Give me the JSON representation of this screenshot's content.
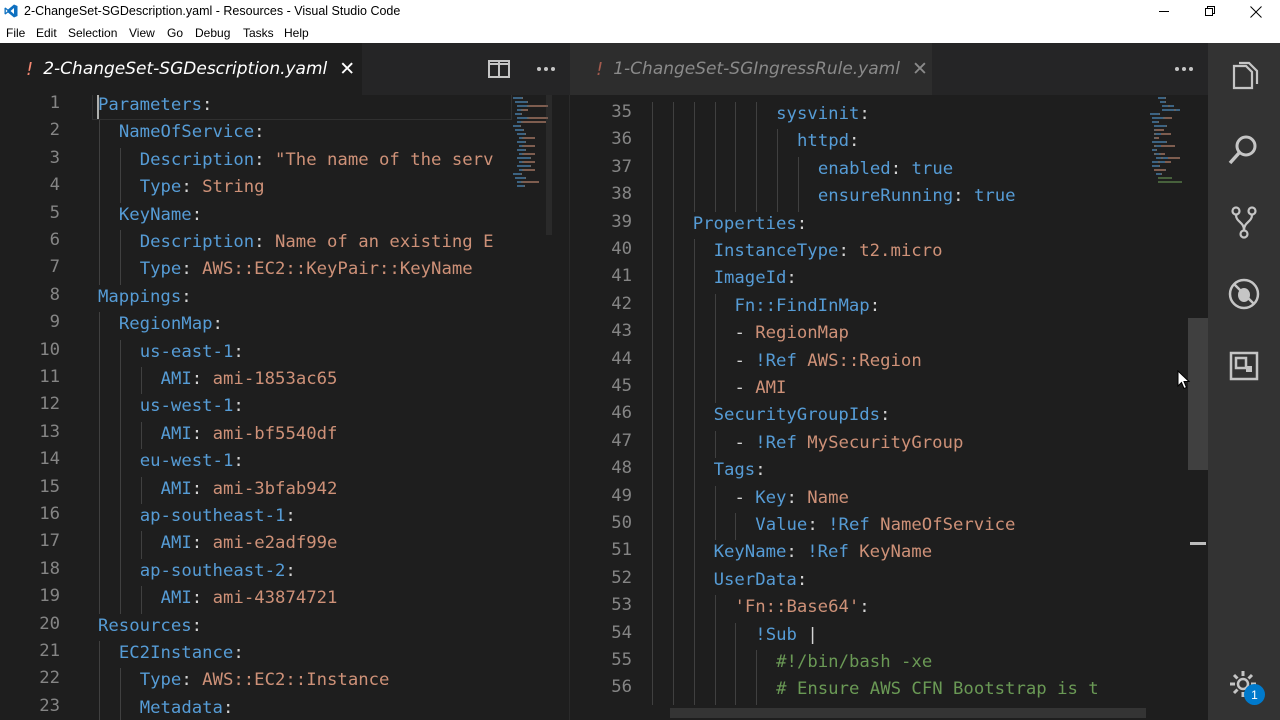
{
  "window": {
    "title": "2-ChangeSet-SGDescription.yaml - Resources - Visual Studio Code",
    "controls": [
      "minimize",
      "maximize",
      "close"
    ]
  },
  "menu": [
    "File",
    "Edit",
    "Selection",
    "View",
    "Go",
    "Debug",
    "Tasks",
    "Help"
  ],
  "left_editor": {
    "tab": {
      "modified_marker": "!",
      "label": "2-ChangeSet-SGDescription.yaml",
      "close": "✕"
    },
    "lines": [
      {
        "n": "1",
        "ind": 0,
        "parts": [
          [
            "k",
            "Parameters"
          ],
          [
            "p",
            ":"
          ]
        ]
      },
      {
        "n": "2",
        "ind": 1,
        "parts": [
          [
            "k",
            "NameOfService"
          ],
          [
            "p",
            ":"
          ]
        ]
      },
      {
        "n": "3",
        "ind": 2,
        "parts": [
          [
            "k",
            "Description"
          ],
          [
            "p",
            ": "
          ],
          [
            "s",
            "\"The name of the serv"
          ]
        ]
      },
      {
        "n": "4",
        "ind": 2,
        "parts": [
          [
            "k",
            "Type"
          ],
          [
            "p",
            ": "
          ],
          [
            "s",
            "String"
          ]
        ]
      },
      {
        "n": "5",
        "ind": 1,
        "parts": [
          [
            "k",
            "KeyName"
          ],
          [
            "p",
            ":"
          ]
        ]
      },
      {
        "n": "6",
        "ind": 2,
        "parts": [
          [
            "k",
            "Description"
          ],
          [
            "p",
            ": "
          ],
          [
            "s",
            "Name of an existing E"
          ]
        ]
      },
      {
        "n": "7",
        "ind": 2,
        "parts": [
          [
            "k",
            "Type"
          ],
          [
            "p",
            ": "
          ],
          [
            "s",
            "AWS::EC2::KeyPair::KeyName"
          ]
        ]
      },
      {
        "n": "8",
        "ind": 0,
        "parts": [
          [
            "k",
            "Mappings"
          ],
          [
            "p",
            ":"
          ]
        ]
      },
      {
        "n": "9",
        "ind": 1,
        "parts": [
          [
            "k",
            "RegionMap"
          ],
          [
            "p",
            ":"
          ]
        ]
      },
      {
        "n": "10",
        "ind": 2,
        "parts": [
          [
            "k",
            "us-east-1"
          ],
          [
            "p",
            ":"
          ]
        ]
      },
      {
        "n": "11",
        "ind": 3,
        "parts": [
          [
            "k",
            "AMI"
          ],
          [
            "p",
            ": "
          ],
          [
            "s",
            "ami-1853ac65"
          ]
        ]
      },
      {
        "n": "12",
        "ind": 2,
        "parts": [
          [
            "k",
            "us-west-1"
          ],
          [
            "p",
            ":"
          ]
        ]
      },
      {
        "n": "13",
        "ind": 3,
        "parts": [
          [
            "k",
            "AMI"
          ],
          [
            "p",
            ": "
          ],
          [
            "s",
            "ami-bf5540df"
          ]
        ]
      },
      {
        "n": "14",
        "ind": 2,
        "parts": [
          [
            "k",
            "eu-west-1"
          ],
          [
            "p",
            ":"
          ]
        ]
      },
      {
        "n": "15",
        "ind": 3,
        "parts": [
          [
            "k",
            "AMI"
          ],
          [
            "p",
            ": "
          ],
          [
            "s",
            "ami-3bfab942"
          ]
        ]
      },
      {
        "n": "16",
        "ind": 2,
        "parts": [
          [
            "k",
            "ap-southeast-1"
          ],
          [
            "p",
            ":"
          ]
        ]
      },
      {
        "n": "17",
        "ind": 3,
        "parts": [
          [
            "k",
            "AMI"
          ],
          [
            "p",
            ": "
          ],
          [
            "s",
            "ami-e2adf99e"
          ]
        ]
      },
      {
        "n": "18",
        "ind": 2,
        "parts": [
          [
            "k",
            "ap-southeast-2"
          ],
          [
            "p",
            ":"
          ]
        ]
      },
      {
        "n": "19",
        "ind": 3,
        "parts": [
          [
            "k",
            "AMI"
          ],
          [
            "p",
            ": "
          ],
          [
            "s",
            "ami-43874721"
          ]
        ]
      },
      {
        "n": "20",
        "ind": 0,
        "parts": [
          [
            "k",
            "Resources"
          ],
          [
            "p",
            ":"
          ]
        ]
      },
      {
        "n": "21",
        "ind": 1,
        "parts": [
          [
            "k",
            "EC2Instance"
          ],
          [
            "p",
            ":"
          ]
        ]
      },
      {
        "n": "22",
        "ind": 2,
        "parts": [
          [
            "k",
            "Type"
          ],
          [
            "p",
            ": "
          ],
          [
            "s",
            "AWS::EC2::Instance"
          ]
        ]
      },
      {
        "n": "23",
        "ind": 2,
        "parts": [
          [
            "k",
            "Metadata"
          ],
          [
            "p",
            ":"
          ]
        ]
      }
    ]
  },
  "right_editor": {
    "tab": {
      "modified_marker": "!",
      "label": "1-ChangeSet-SGIngressRule.yaml",
      "close": "✕"
    },
    "lines": [
      {
        "n": "35",
        "ind": 6,
        "parts": [
          [
            "k",
            "sysvinit"
          ],
          [
            "p",
            ":"
          ]
        ]
      },
      {
        "n": "36",
        "ind": 7,
        "parts": [
          [
            "k",
            "httpd"
          ],
          [
            "p",
            ":"
          ]
        ]
      },
      {
        "n": "37",
        "ind": 8,
        "parts": [
          [
            "k",
            "enabled"
          ],
          [
            "p",
            ": "
          ],
          [
            "b",
            "true"
          ]
        ]
      },
      {
        "n": "38",
        "ind": 8,
        "parts": [
          [
            "k",
            "ensureRunning"
          ],
          [
            "p",
            ": "
          ],
          [
            "b",
            "true"
          ]
        ]
      },
      {
        "n": "39",
        "ind": 2,
        "parts": [
          [
            "k",
            "Properties"
          ],
          [
            "p",
            ":"
          ]
        ]
      },
      {
        "n": "40",
        "ind": 3,
        "parts": [
          [
            "k",
            "InstanceType"
          ],
          [
            "p",
            ": "
          ],
          [
            "s",
            "t2.micro"
          ]
        ]
      },
      {
        "n": "41",
        "ind": 3,
        "parts": [
          [
            "k",
            "ImageId"
          ],
          [
            "p",
            ":"
          ]
        ]
      },
      {
        "n": "42",
        "ind": 4,
        "parts": [
          [
            "k",
            "Fn::FindInMap"
          ],
          [
            "p",
            ":"
          ]
        ]
      },
      {
        "n": "43",
        "ind": 4,
        "parts": [
          [
            "p",
            "- "
          ],
          [
            "s",
            "RegionMap"
          ]
        ]
      },
      {
        "n": "44",
        "ind": 4,
        "parts": [
          [
            "p",
            "- "
          ],
          [
            "k",
            "!Ref "
          ],
          [
            "s",
            "AWS::Region"
          ]
        ]
      },
      {
        "n": "45",
        "ind": 4,
        "parts": [
          [
            "p",
            "- "
          ],
          [
            "s",
            "AMI"
          ]
        ]
      },
      {
        "n": "46",
        "ind": 3,
        "parts": [
          [
            "k",
            "SecurityGroupIds"
          ],
          [
            "p",
            ":"
          ]
        ]
      },
      {
        "n": "47",
        "ind": 4,
        "parts": [
          [
            "p",
            "- "
          ],
          [
            "k",
            "!Ref "
          ],
          [
            "s",
            "MySecurityGroup"
          ]
        ]
      },
      {
        "n": "48",
        "ind": 3,
        "parts": [
          [
            "k",
            "Tags"
          ],
          [
            "p",
            ":"
          ]
        ]
      },
      {
        "n": "49",
        "ind": 4,
        "parts": [
          [
            "p",
            "- "
          ],
          [
            "k",
            "Key"
          ],
          [
            "p",
            ": "
          ],
          [
            "s",
            "Name"
          ]
        ]
      },
      {
        "n": "50",
        "ind": 5,
        "parts": [
          [
            "k",
            "Value"
          ],
          [
            "p",
            ": "
          ],
          [
            "k",
            "!Ref "
          ],
          [
            "s",
            "NameOfService"
          ]
        ]
      },
      {
        "n": "51",
        "ind": 3,
        "parts": [
          [
            "k",
            "KeyName"
          ],
          [
            "p",
            ": "
          ],
          [
            "k",
            "!Ref "
          ],
          [
            "s",
            "KeyName"
          ]
        ]
      },
      {
        "n": "52",
        "ind": 3,
        "parts": [
          [
            "k",
            "UserData"
          ],
          [
            "p",
            ":"
          ]
        ]
      },
      {
        "n": "53",
        "ind": 4,
        "parts": [
          [
            "s",
            "'Fn::Base64'"
          ],
          [
            "p",
            ":"
          ]
        ]
      },
      {
        "n": "54",
        "ind": 5,
        "parts": [
          [
            "k",
            "!Sub "
          ],
          [
            "p",
            "|"
          ]
        ]
      },
      {
        "n": "55",
        "ind": 6,
        "parts": [
          [
            "c",
            "#!/bin/bash -xe"
          ]
        ]
      },
      {
        "n": "56",
        "ind": 6,
        "parts": [
          [
            "c",
            "# Ensure AWS CFN Bootstrap is t"
          ]
        ]
      }
    ]
  },
  "activity_bar": {
    "icons": [
      "explorer-icon",
      "search-icon",
      "source-control-icon",
      "debug-icon",
      "extensions-icon"
    ],
    "settings_badge": "1"
  },
  "colors": {
    "key": "#569cd6",
    "string": "#ce9178",
    "comment": "#6a9955",
    "line_number": "#858585",
    "background": "#1e1e1e",
    "activity_bar": "#333333"
  }
}
